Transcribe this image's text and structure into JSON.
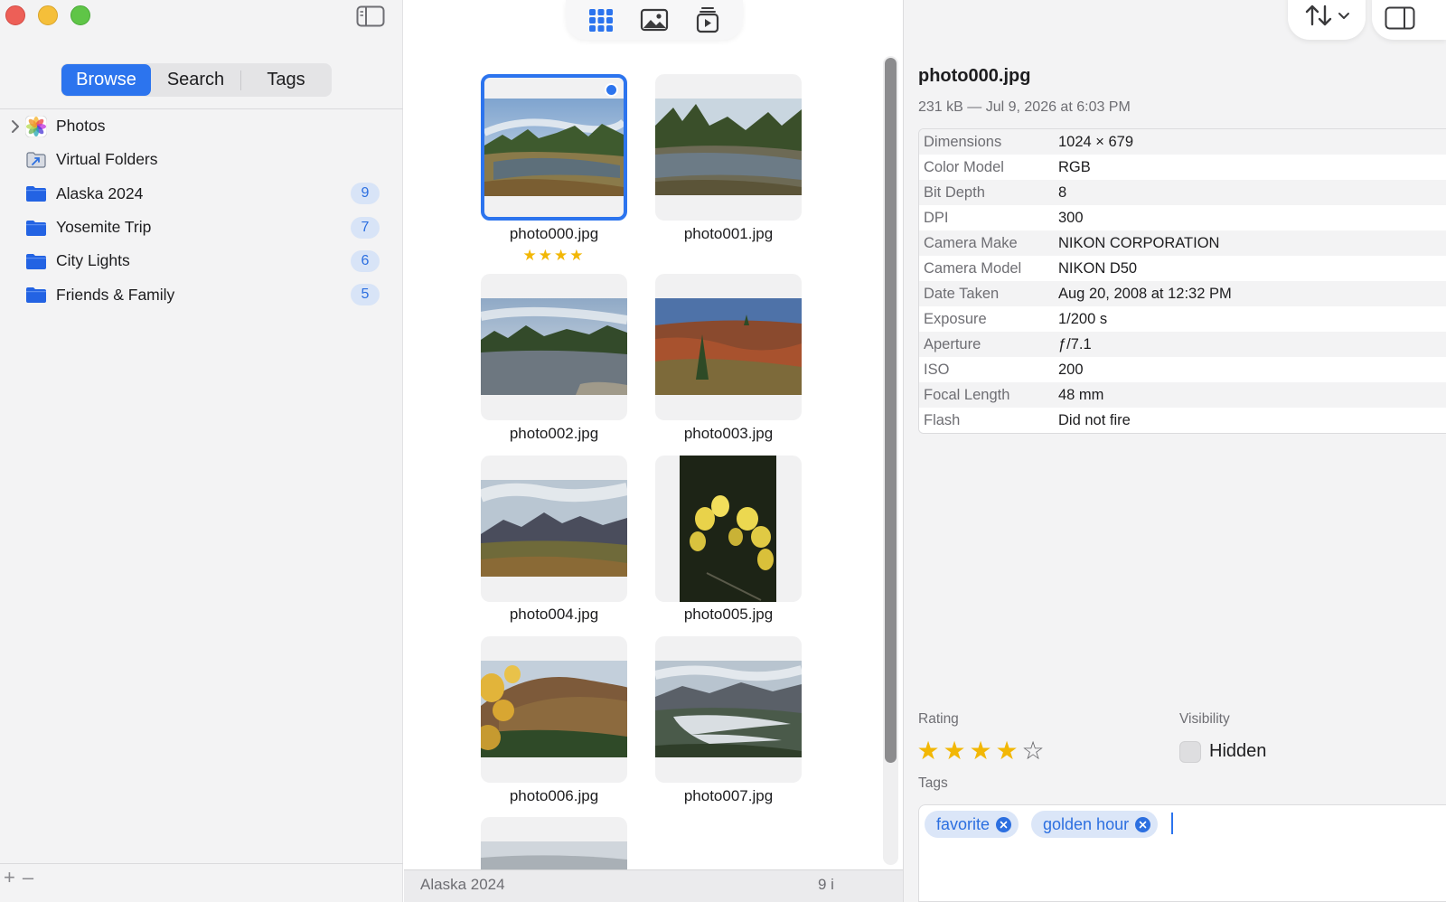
{
  "sidebar": {
    "segments": [
      "Browse",
      "Search",
      "Tags"
    ],
    "active_segment": "Browse",
    "items": [
      {
        "label": "Photos",
        "icon": "photos-app-icon",
        "count": ""
      },
      {
        "label": "Virtual Folders",
        "icon": "virtual-folder-icon",
        "count": ""
      },
      {
        "label": "Alaska 2024",
        "icon": "folder-icon",
        "count": "9"
      },
      {
        "label": "Yosemite Trip",
        "icon": "folder-icon",
        "count": "7"
      },
      {
        "label": "City Lights",
        "icon": "folder-icon",
        "count": "6"
      },
      {
        "label": "Friends & Family",
        "icon": "folder-icon",
        "count": "5"
      }
    ],
    "add_label": "+",
    "remove_label": "–"
  },
  "grid": {
    "items": [
      {
        "name": "photo000.jpg",
        "selected": true,
        "stars": "★★★★",
        "rating": 4
      },
      {
        "name": "photo001.jpg",
        "selected": false,
        "stars": ""
      },
      {
        "name": "photo002.jpg",
        "selected": false,
        "stars": ""
      },
      {
        "name": "photo003.jpg",
        "selected": false,
        "stars": ""
      },
      {
        "name": "photo004.jpg",
        "selected": false,
        "stars": ""
      },
      {
        "name": "photo005.jpg",
        "selected": false,
        "stars": ""
      },
      {
        "name": "photo006.jpg",
        "selected": false,
        "stars": ""
      },
      {
        "name": "photo007.jpg",
        "selected": false,
        "stars": ""
      }
    ]
  },
  "status": {
    "folder": "Alaska 2024",
    "count": "9 i"
  },
  "inspector": {
    "filename": "photo000.jpg",
    "summary": "231 kB — Jul 9, 2026 at 6:03 PM",
    "metadata": [
      {
        "key": "Dimensions",
        "value": "1024 × 679"
      },
      {
        "key": "Color Model",
        "value": "RGB"
      },
      {
        "key": "Bit Depth",
        "value": "8"
      },
      {
        "key": "DPI",
        "value": "300"
      },
      {
        "key": "Camera Make",
        "value": "NIKON CORPORATION"
      },
      {
        "key": "Camera Model",
        "value": "NIKON D50"
      },
      {
        "key": "Date Taken",
        "value": "Aug 20, 2008 at 12:32 PM"
      },
      {
        "key": "Exposure",
        "value": "1/200 s"
      },
      {
        "key": "Aperture",
        "value": "ƒ/7.1"
      },
      {
        "key": "ISO",
        "value": "200"
      },
      {
        "key": "Focal Length",
        "value": "48 mm"
      },
      {
        "key": "Flash",
        "value": "Did not fire"
      }
    ],
    "rating_label": "Rating",
    "rating_value": 4,
    "rating_max": 5,
    "visibility_label": "Visibility",
    "hidden_label": "Hidden",
    "hidden_checked": false,
    "tags_label": "Tags",
    "tags": [
      "favorite",
      "golden hour"
    ]
  },
  "colors": {
    "accent": "#2c74ee",
    "star": "#f2b705",
    "badge_bg": "#d8e4f7"
  }
}
